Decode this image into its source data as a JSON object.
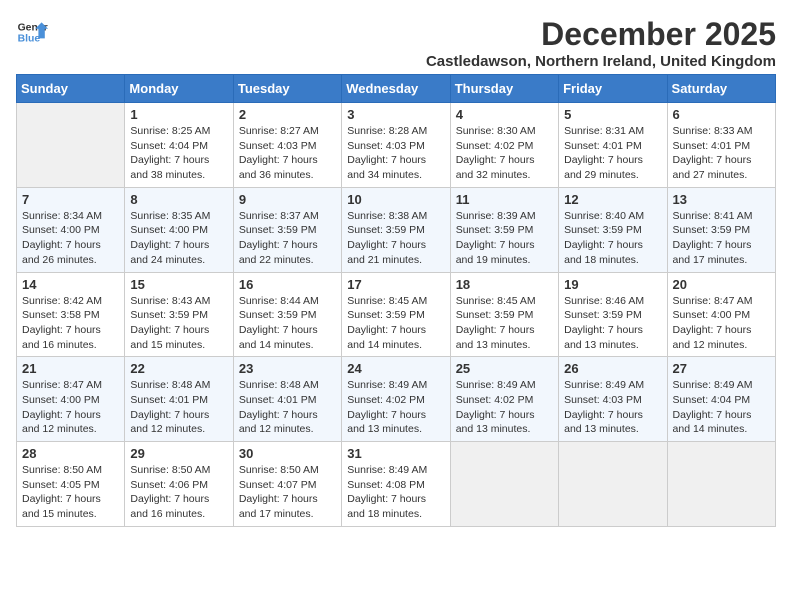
{
  "header": {
    "logo_line1": "General",
    "logo_line2": "Blue",
    "month": "December 2025",
    "location": "Castledawson, Northern Ireland, United Kingdom"
  },
  "weekdays": [
    "Sunday",
    "Monday",
    "Tuesday",
    "Wednesday",
    "Thursday",
    "Friday",
    "Saturday"
  ],
  "weeks": [
    [
      {
        "day": "",
        "sunrise": "",
        "sunset": "",
        "daylight": ""
      },
      {
        "day": "1",
        "sunrise": "8:25 AM",
        "sunset": "4:04 PM",
        "daylight": "7 hours and 38 minutes."
      },
      {
        "day": "2",
        "sunrise": "8:27 AM",
        "sunset": "4:03 PM",
        "daylight": "7 hours and 36 minutes."
      },
      {
        "day": "3",
        "sunrise": "8:28 AM",
        "sunset": "4:03 PM",
        "daylight": "7 hours and 34 minutes."
      },
      {
        "day": "4",
        "sunrise": "8:30 AM",
        "sunset": "4:02 PM",
        "daylight": "7 hours and 32 minutes."
      },
      {
        "day": "5",
        "sunrise": "8:31 AM",
        "sunset": "4:01 PM",
        "daylight": "7 hours and 29 minutes."
      },
      {
        "day": "6",
        "sunrise": "8:33 AM",
        "sunset": "4:01 PM",
        "daylight": "7 hours and 27 minutes."
      }
    ],
    [
      {
        "day": "7",
        "sunrise": "8:34 AM",
        "sunset": "4:00 PM",
        "daylight": "7 hours and 26 minutes."
      },
      {
        "day": "8",
        "sunrise": "8:35 AM",
        "sunset": "4:00 PM",
        "daylight": "7 hours and 24 minutes."
      },
      {
        "day": "9",
        "sunrise": "8:37 AM",
        "sunset": "3:59 PM",
        "daylight": "7 hours and 22 minutes."
      },
      {
        "day": "10",
        "sunrise": "8:38 AM",
        "sunset": "3:59 PM",
        "daylight": "7 hours and 21 minutes."
      },
      {
        "day": "11",
        "sunrise": "8:39 AM",
        "sunset": "3:59 PM",
        "daylight": "7 hours and 19 minutes."
      },
      {
        "day": "12",
        "sunrise": "8:40 AM",
        "sunset": "3:59 PM",
        "daylight": "7 hours and 18 minutes."
      },
      {
        "day": "13",
        "sunrise": "8:41 AM",
        "sunset": "3:59 PM",
        "daylight": "7 hours and 17 minutes."
      }
    ],
    [
      {
        "day": "14",
        "sunrise": "8:42 AM",
        "sunset": "3:58 PM",
        "daylight": "7 hours and 16 minutes."
      },
      {
        "day": "15",
        "sunrise": "8:43 AM",
        "sunset": "3:59 PM",
        "daylight": "7 hours and 15 minutes."
      },
      {
        "day": "16",
        "sunrise": "8:44 AM",
        "sunset": "3:59 PM",
        "daylight": "7 hours and 14 minutes."
      },
      {
        "day": "17",
        "sunrise": "8:45 AM",
        "sunset": "3:59 PM",
        "daylight": "7 hours and 14 minutes."
      },
      {
        "day": "18",
        "sunrise": "8:45 AM",
        "sunset": "3:59 PM",
        "daylight": "7 hours and 13 minutes."
      },
      {
        "day": "19",
        "sunrise": "8:46 AM",
        "sunset": "3:59 PM",
        "daylight": "7 hours and 13 minutes."
      },
      {
        "day": "20",
        "sunrise": "8:47 AM",
        "sunset": "4:00 PM",
        "daylight": "7 hours and 12 minutes."
      }
    ],
    [
      {
        "day": "21",
        "sunrise": "8:47 AM",
        "sunset": "4:00 PM",
        "daylight": "7 hours and 12 minutes."
      },
      {
        "day": "22",
        "sunrise": "8:48 AM",
        "sunset": "4:01 PM",
        "daylight": "7 hours and 12 minutes."
      },
      {
        "day": "23",
        "sunrise": "8:48 AM",
        "sunset": "4:01 PM",
        "daylight": "7 hours and 12 minutes."
      },
      {
        "day": "24",
        "sunrise": "8:49 AM",
        "sunset": "4:02 PM",
        "daylight": "7 hours and 13 minutes."
      },
      {
        "day": "25",
        "sunrise": "8:49 AM",
        "sunset": "4:02 PM",
        "daylight": "7 hours and 13 minutes."
      },
      {
        "day": "26",
        "sunrise": "8:49 AM",
        "sunset": "4:03 PM",
        "daylight": "7 hours and 13 minutes."
      },
      {
        "day": "27",
        "sunrise": "8:49 AM",
        "sunset": "4:04 PM",
        "daylight": "7 hours and 14 minutes."
      }
    ],
    [
      {
        "day": "28",
        "sunrise": "8:50 AM",
        "sunset": "4:05 PM",
        "daylight": "7 hours and 15 minutes."
      },
      {
        "day": "29",
        "sunrise": "8:50 AM",
        "sunset": "4:06 PM",
        "daylight": "7 hours and 16 minutes."
      },
      {
        "day": "30",
        "sunrise": "8:50 AM",
        "sunset": "4:07 PM",
        "daylight": "7 hours and 17 minutes."
      },
      {
        "day": "31",
        "sunrise": "8:49 AM",
        "sunset": "4:08 PM",
        "daylight": "7 hours and 18 minutes."
      },
      {
        "day": "",
        "sunrise": "",
        "sunset": "",
        "daylight": ""
      },
      {
        "day": "",
        "sunrise": "",
        "sunset": "",
        "daylight": ""
      },
      {
        "day": "",
        "sunrise": "",
        "sunset": "",
        "daylight": ""
      }
    ]
  ]
}
